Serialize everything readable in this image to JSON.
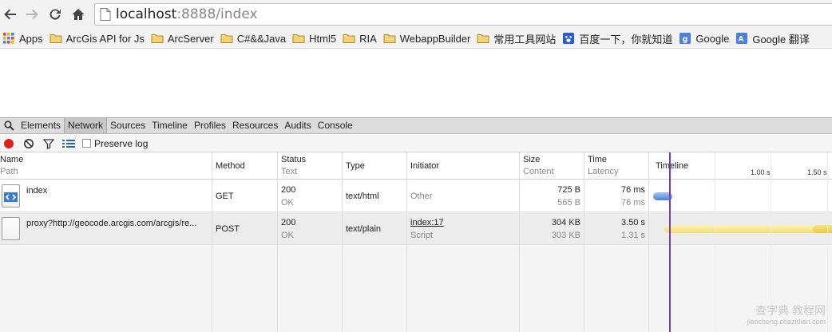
{
  "browser": {
    "url_host": "localhost",
    "url_rest": ":8888/index"
  },
  "bookmarks": [
    {
      "label": "Apps",
      "icon": "apps-grid-icon"
    },
    {
      "label": "ArcGis API for Js",
      "icon": "folder-icon"
    },
    {
      "label": "ArcServer",
      "icon": "folder-icon"
    },
    {
      "label": "C#&&Java",
      "icon": "folder-icon"
    },
    {
      "label": "Html5",
      "icon": "folder-icon"
    },
    {
      "label": "RIA",
      "icon": "folder-icon"
    },
    {
      "label": "WebappBuilder",
      "icon": "folder-icon"
    },
    {
      "label": "常用工具网站",
      "icon": "folder-icon"
    },
    {
      "label": "百度一下，你就知道",
      "icon": "baidu-icon"
    },
    {
      "label": "Google",
      "icon": "google-icon"
    },
    {
      "label": "Google 翻译",
      "icon": "google-translate-icon"
    }
  ],
  "devtools": {
    "tabs": [
      "Elements",
      "Network",
      "Sources",
      "Timeline",
      "Profiles",
      "Resources",
      "Audits",
      "Console"
    ],
    "active_tab": "Network",
    "preserve_log": "Preserve log",
    "headers": {
      "name": "Name",
      "name_sub": "Path",
      "method": "Method",
      "status": "Status",
      "status_sub": "Text",
      "type": "Type",
      "initiator": "Initiator",
      "size": "Size",
      "size_sub": "Content",
      "time": "Time",
      "time_sub": "Latency",
      "timeline": "Timeline"
    },
    "timeline_ticks": [
      "1.00 s",
      "1.50 s"
    ],
    "requests": [
      {
        "name": "index",
        "method": "GET",
        "status": "200",
        "status_text": "OK",
        "type": "text/html",
        "initiator": "Other",
        "initiator_sub": "",
        "size": "725 B",
        "content": "565 B",
        "time": "76 ms",
        "latency": "76 ms"
      },
      {
        "name": "proxy?http://geocode.arcgis.com/arcgis/re...",
        "method": "POST",
        "status": "200",
        "status_text": "OK",
        "type": "text/plain",
        "initiator": "index:17",
        "initiator_sub": "Script",
        "size": "304 KB",
        "content": "303 KB",
        "time": "3.50 s",
        "latency": "1.31 s"
      }
    ]
  },
  "watermark": {
    "line1": "查字典 教程网",
    "line2": "jiaocheng.chazidian.com"
  },
  "colors": {
    "record": "#e0201d",
    "timeline_marker": "#7b3fa6",
    "bar_blue": "#4a7fe0",
    "bar_yellow": "#f1dd70"
  }
}
